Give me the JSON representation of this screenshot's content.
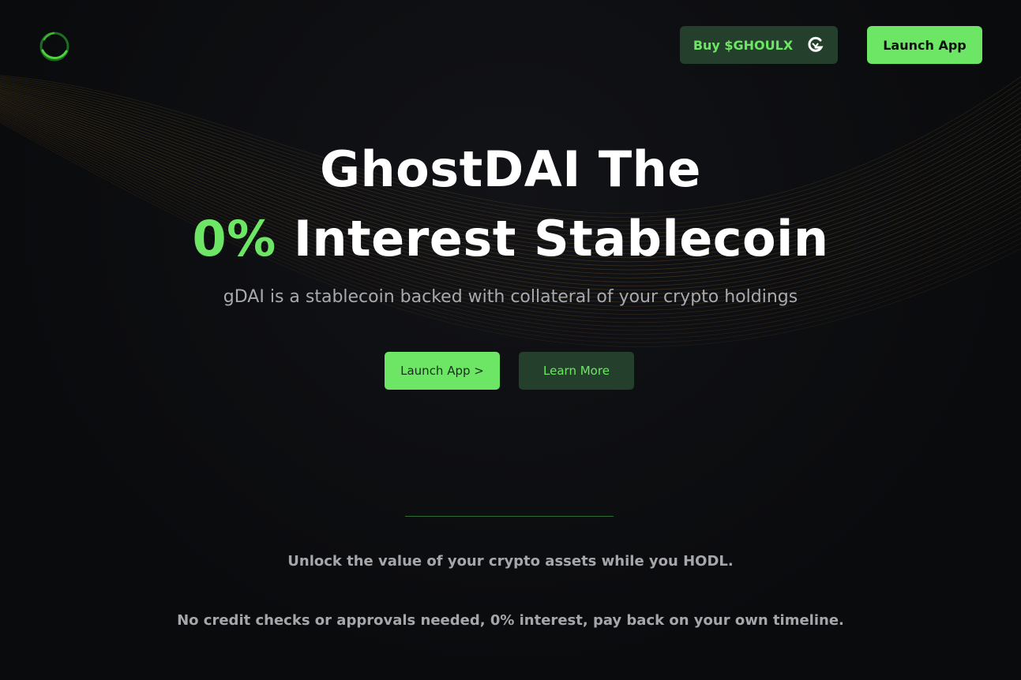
{
  "header": {
    "logo_icon": "ring-logo-icon",
    "buy_label": "Buy $GHOULX",
    "buy_icon": "ghoulx-g-icon",
    "launch_label": "Launch App"
  },
  "hero": {
    "title_line1": "GhostDAI The",
    "title_accent": "0%",
    "title_line2_rest": " Interest Stablecoin",
    "subtitle": "gDAI is a stablecoin backed with collateral of your crypto holdings",
    "launch_label": "Launch App >",
    "learn_label": "Learn More"
  },
  "info": {
    "line1": "Unlock the value of your crypto assets while you HODL.",
    "line2": "No credit checks or approvals needed, 0% interest, pay back on your own timeline."
  },
  "colors": {
    "accent": "#6ee665",
    "dark_button": "#24402c",
    "background": "#0b0c0f"
  }
}
